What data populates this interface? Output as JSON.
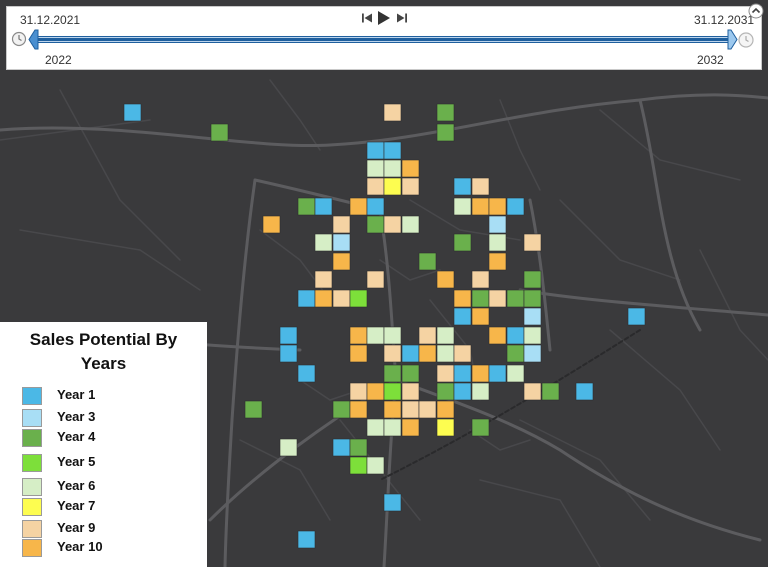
{
  "time_slider": {
    "start_date": "31.12.2021",
    "end_date": "31.12.2031",
    "start_tick": "2022",
    "end_tick": "2032"
  },
  "legend": {
    "title_line1": "Sales Potential By",
    "title_line2": "Years",
    "items": [
      {
        "label": "Year 1",
        "color": "#4bb8e6"
      },
      {
        "label": "Year 3",
        "color": "#a8def5"
      },
      {
        "label": "Year 4",
        "color": "#6ab04c"
      },
      {
        "label": "Year 5",
        "color": "#7ddf3a"
      },
      {
        "label": "Year 6",
        "color": "#d6eec6"
      },
      {
        "label": "Year 7",
        "color": "#fdfd50"
      },
      {
        "label": "Year 9",
        "color": "#f5d3a3"
      },
      {
        "label": "Year 10",
        "color": "#f7b64a"
      }
    ]
  },
  "colors": {
    "map_background": "#3a3a3c",
    "road_major": "#5c5c5f",
    "slider_track": "#1f5f9e"
  },
  "icons": {
    "previous": "skip-back-icon",
    "play": "play-icon",
    "next": "skip-forward-icon",
    "collapse": "chevron-up-icon",
    "settings": "clock-settings-icon"
  }
}
